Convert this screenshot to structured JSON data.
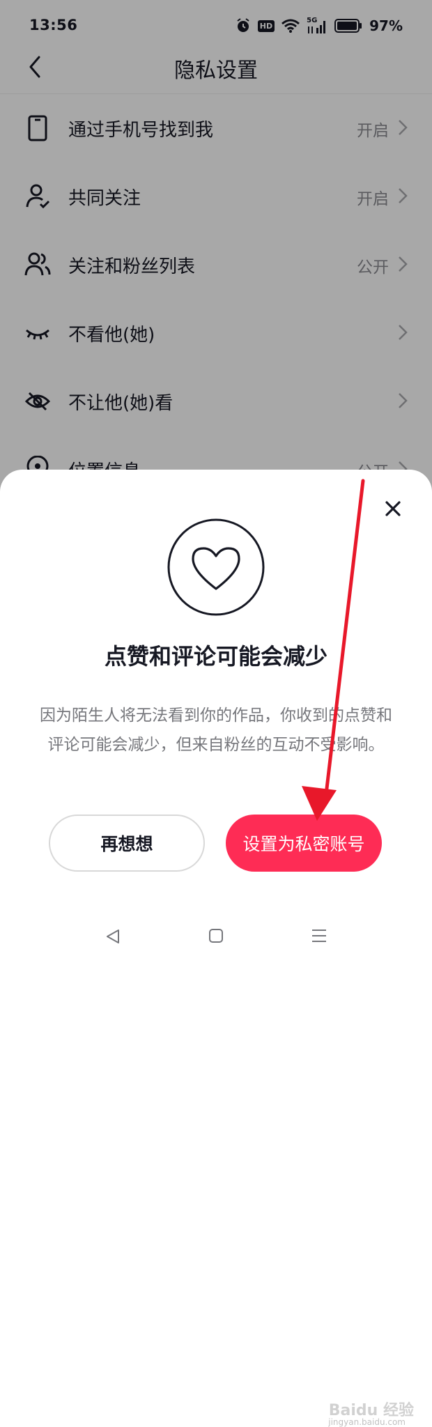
{
  "status": {
    "time": "13:56",
    "hd": "HD",
    "network": "5G",
    "battery": "97%"
  },
  "header": {
    "title": "隐私设置"
  },
  "settings": [
    {
      "label": "通过手机号找到我",
      "value": "开启",
      "icon": "phone-icon"
    },
    {
      "label": "共同关注",
      "value": "开启",
      "icon": "user-check-icon"
    },
    {
      "label": "关注和粉丝列表",
      "value": "公开",
      "icon": "users-icon"
    },
    {
      "label": "不看他(她)",
      "value": "",
      "icon": "closed-eye-icon"
    },
    {
      "label": "不让他(她)看",
      "value": "",
      "icon": "eye-off-icon"
    },
    {
      "label": "位置信息",
      "value": "公开",
      "icon": "location-icon"
    }
  ],
  "dialog": {
    "title": "点赞和评论可能会减少",
    "description": "因为陌生人将无法看到你的作品，你收到的点赞和评论可能会减少，但来自粉丝的互动不受影响。",
    "cancel_label": "再想想",
    "confirm_label": "设置为私密账号",
    "icon": "heart-icon"
  },
  "watermark": {
    "text": "Baidu 经验",
    "sub": "jingyan.baidu.com"
  },
  "colors": {
    "accent": "#fe2c55",
    "arrow": "#e8182a"
  }
}
